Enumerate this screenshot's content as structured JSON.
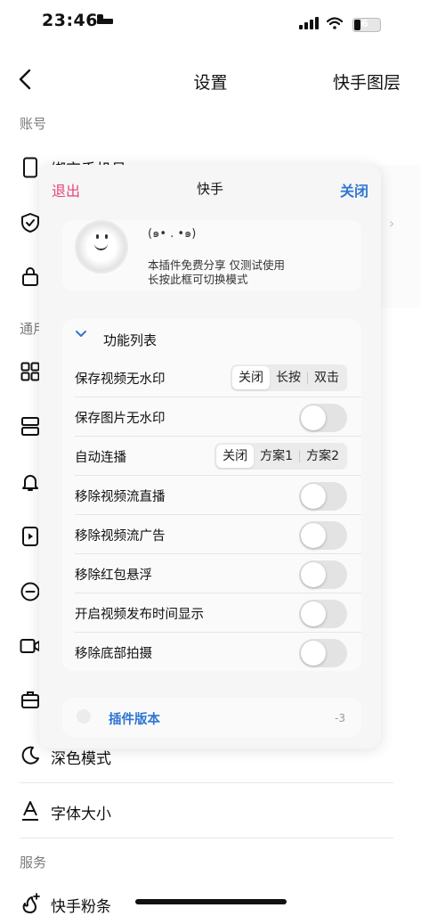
{
  "status_bar": {
    "time": "23:46",
    "battery": "6"
  },
  "nav": {
    "title": "设置",
    "right_label": "快手图层"
  },
  "settings": {
    "section_account": "账号",
    "section_general": "通用",
    "section_service": "服务",
    "account_partial_label": "绑定手机号",
    "dark_mode": "深色模式",
    "font_size": "字体大小",
    "fans_label": "快手粉条"
  },
  "panel": {
    "exit": "退出",
    "title": "快手",
    "close": "关闭",
    "kaomoji": "(๑• . •๑)",
    "desc_line1": "本插件免费分享 仅测试使用",
    "desc_line2": "长按此框可切换模式",
    "features_header": "功能列表",
    "features": [
      {
        "label": "保存视频无水印",
        "type": "segment",
        "options": [
          "关闭",
          "长按",
          "双击"
        ],
        "selected": "关闭"
      },
      {
        "label": "保存图片无水印",
        "type": "toggle",
        "on": false
      },
      {
        "label": "自动连播",
        "type": "segment",
        "options": [
          "关闭",
          "方案1",
          "方案2"
        ],
        "selected": "关闭"
      },
      {
        "label": "移除视频流直播",
        "type": "toggle",
        "on": false
      },
      {
        "label": "移除视频流广告",
        "type": "toggle",
        "on": false
      },
      {
        "label": "移除红包悬浮",
        "type": "toggle",
        "on": false
      },
      {
        "label": "开启视频发布时间显示",
        "type": "toggle",
        "on": false
      },
      {
        "label": "移除底部拍摄",
        "type": "toggle",
        "on": false
      }
    ],
    "version_label": "插件版本",
    "version_value": "-3"
  },
  "colors": {
    "exit": "#e8447a",
    "accent_blue": "#2f76d2",
    "toggle_off": "#e3e3e3"
  },
  "icons": [
    "back-chevron-icon",
    "phone-icon",
    "shield-check-icon",
    "lock-icon",
    "grid-icon",
    "layers-icon",
    "bell-icon",
    "play-square-icon",
    "minus-circle-icon",
    "camera-icon",
    "toolbox-icon",
    "moon-icon",
    "font-size-icon",
    "sparkle-icon",
    "smiley-icon"
  ]
}
